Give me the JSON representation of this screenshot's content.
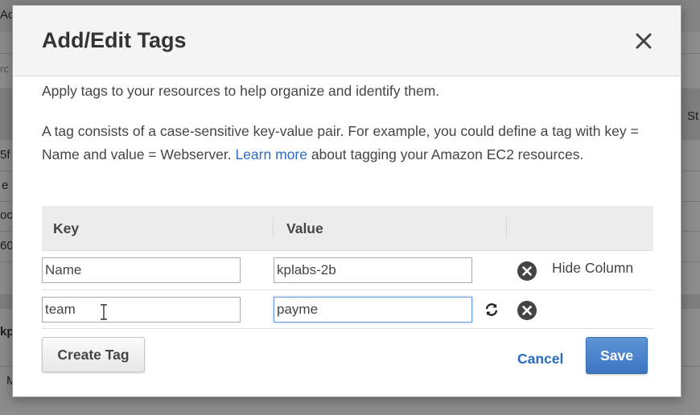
{
  "background": {
    "fragments": [
      "Ac",
      "rc",
      "St",
      "5f",
      "e",
      "oc",
      "60",
      "kp",
      "M"
    ]
  },
  "dialog": {
    "title": "Add/Edit Tags",
    "close_icon": "close-icon",
    "intro": "Apply tags to your resources to help organize and identify them.",
    "description_before_link": "A tag consists of a case-sensitive key-value pair. For example, you could define a tag with key = Name and value = Webserver.",
    "learn_more_link": "Learn more",
    "description_after_link": "about tagging your Amazon EC2 resources.",
    "table": {
      "columns": [
        "Key",
        "Value"
      ],
      "rows": [
        {
          "key": "Name",
          "value": "kplabs-2b",
          "hide_column_label": "Hide Column"
        },
        {
          "key": "team",
          "value": "payme"
        }
      ]
    },
    "buttons": {
      "create_tag": "Create Tag",
      "cancel": "Cancel",
      "save": "Save"
    },
    "colors": {
      "link": "#2c6bbf",
      "primary_button": "#4a85cc",
      "header_bg": "#f4f4f4"
    }
  }
}
